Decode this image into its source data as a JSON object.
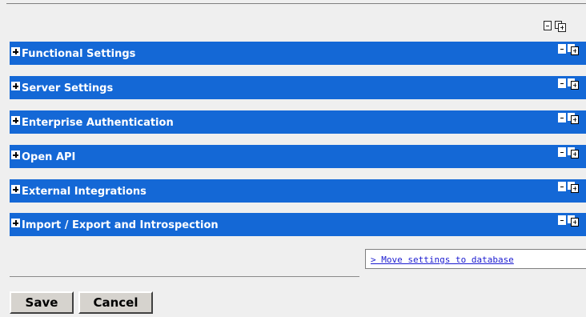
{
  "global_tools": {
    "collapse_icon": "collapse-all-icon",
    "expand_icon": "expand-all-icon"
  },
  "sections": [
    {
      "title": "Functional Settings"
    },
    {
      "title": "Server Settings"
    },
    {
      "title": "Enterprise Authentication"
    },
    {
      "title": "Open API"
    },
    {
      "title": "External Integrations"
    },
    {
      "title": "Import / Export and Introspection"
    }
  ],
  "move_link": "> Move settings to database",
  "buttons": {
    "save": "Save",
    "cancel": "Cancel"
  },
  "colors": {
    "section_bar": "#1468d6",
    "page_bg": "#efefef",
    "link": "#1b1bd0"
  }
}
